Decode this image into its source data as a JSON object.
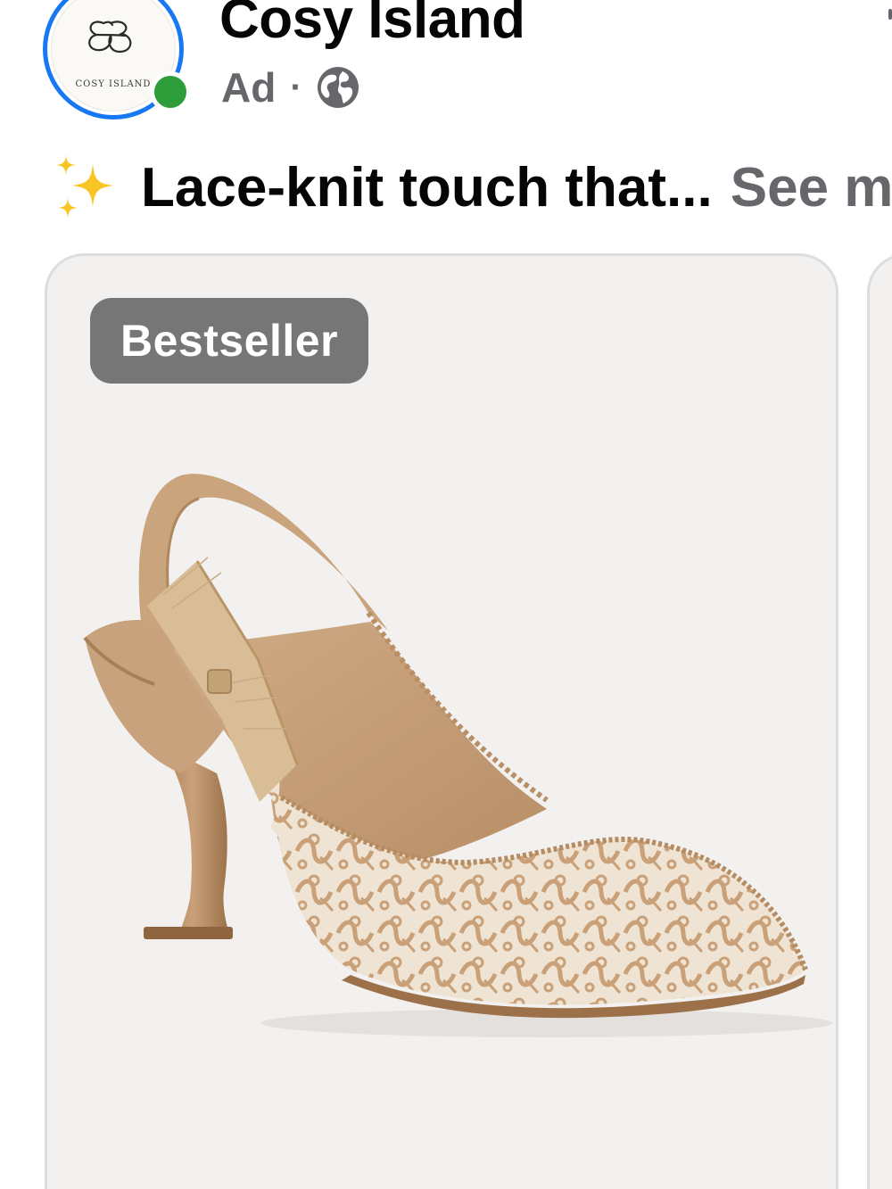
{
  "post": {
    "page_name": "Cosy Island",
    "meta_label": "Ad",
    "meta_separator": "·",
    "privacy_icon": "globe-icon",
    "caption_emoji": "sparkles-icon",
    "caption_text": "Lace-knit touch that...",
    "see_more_label": "See more"
  },
  "avatar": {
    "brand_text": "COSY ISLAND",
    "ring_color": "#1877f2",
    "online_color": "#2e9e3a"
  },
  "carousel": {
    "cards": [
      {
        "badge": "Bestseller",
        "image_subject": "beige lace-knit slingback pointed-toe heel with bow"
      }
    ]
  },
  "colors": {
    "text_primary": "#050505",
    "text_secondary": "#65676b",
    "badge_bg": "#767676",
    "card_bg": "#f2f1ef"
  }
}
